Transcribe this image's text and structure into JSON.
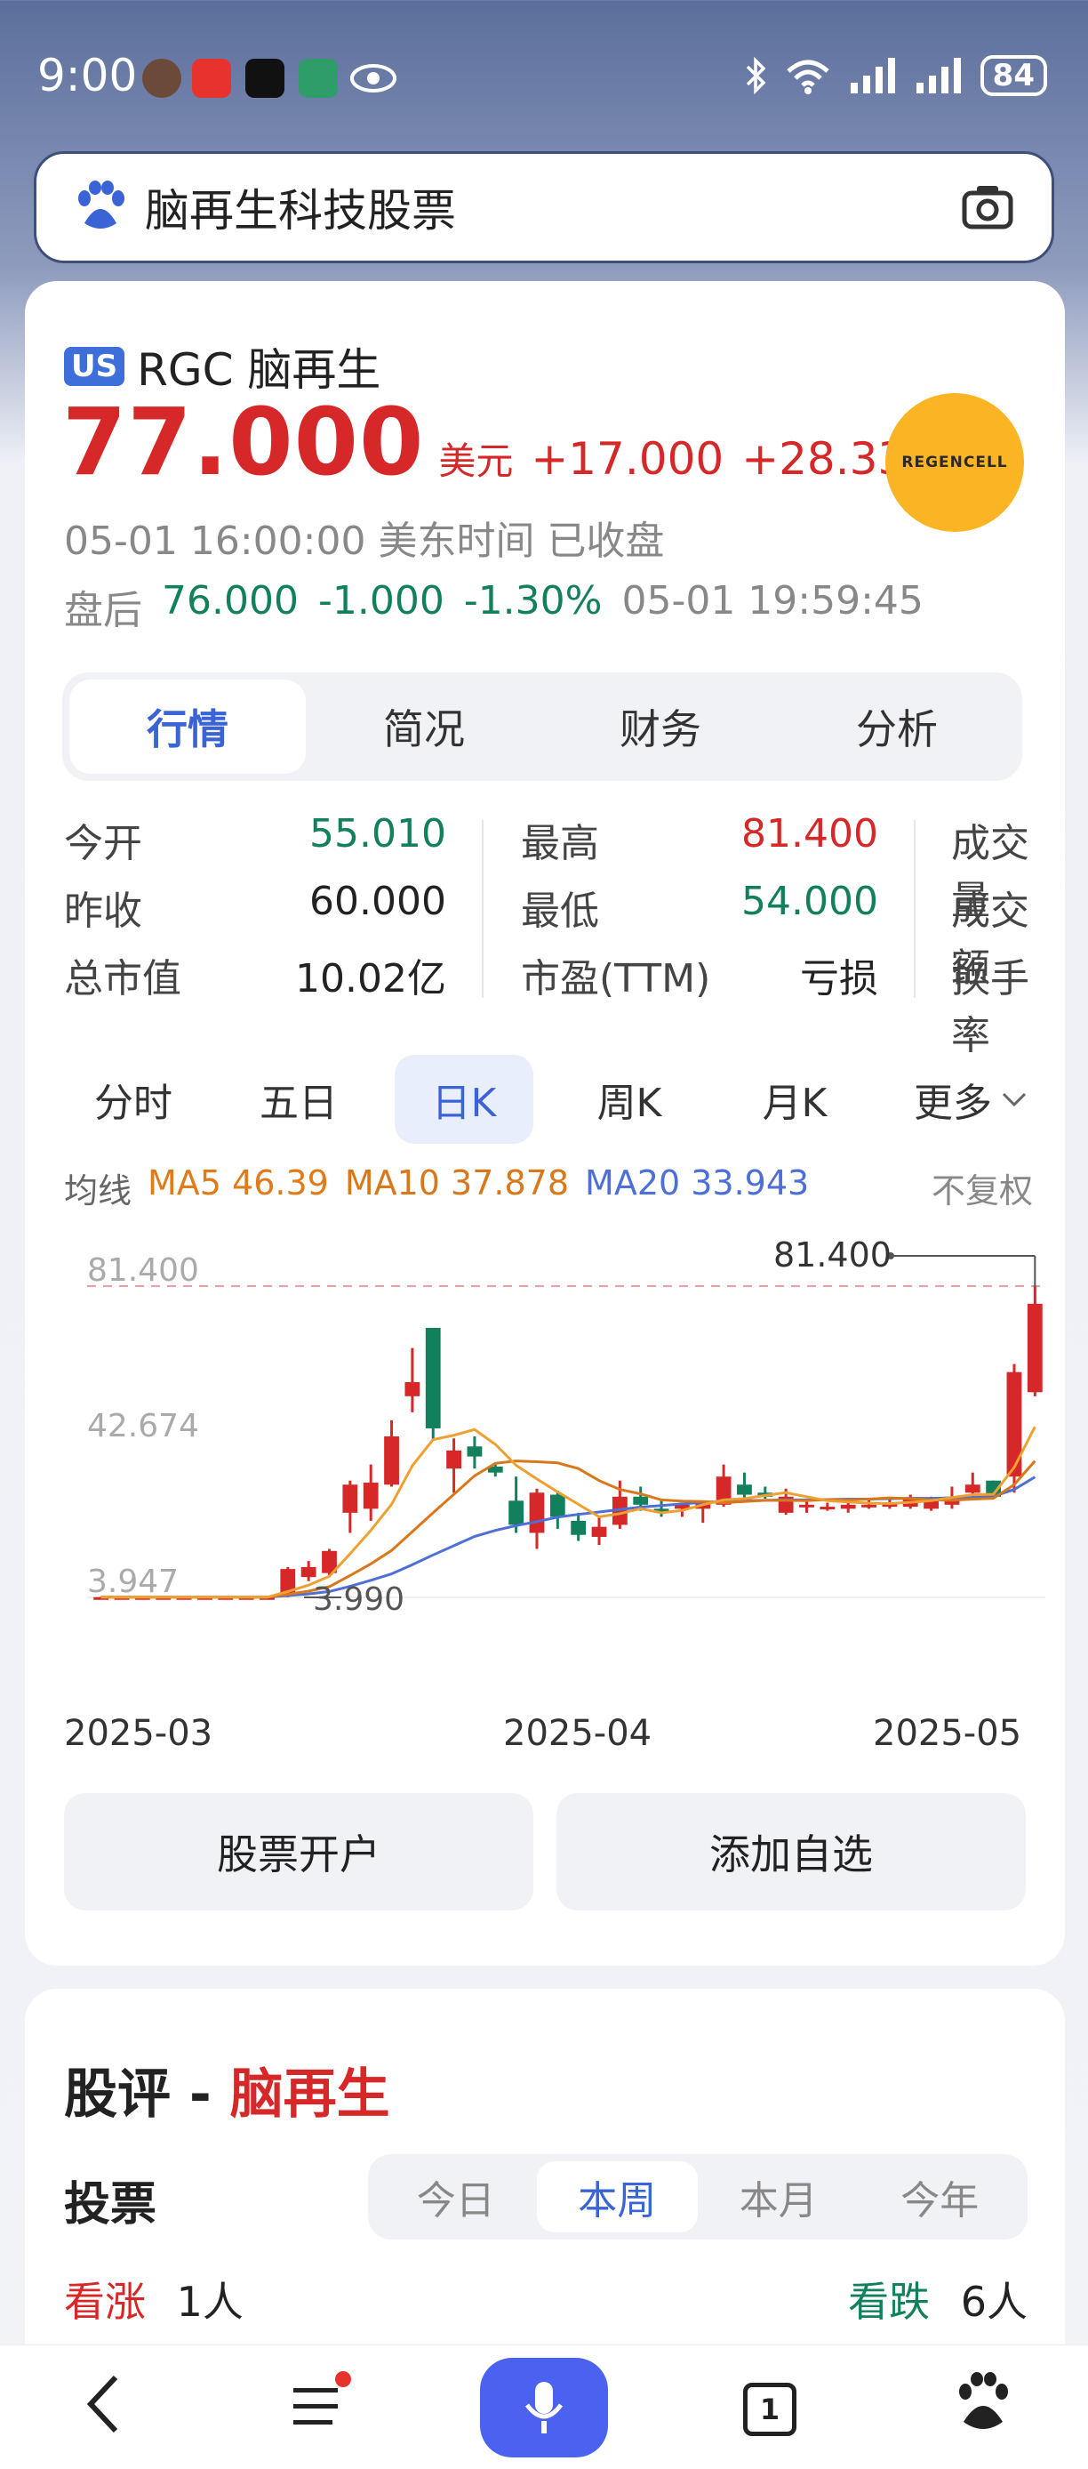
{
  "status_bar": {
    "time": "9:00",
    "battery": "84"
  },
  "search": {
    "query": "脑再生科技股票"
  },
  "stock": {
    "market_badge": "US",
    "name": "RGC 脑再生",
    "price": "77.000",
    "currency": "美元",
    "change": "+17.000",
    "change_pct": "+28.33%",
    "quote_time": "05-01 16:00:00 美东时间 已收盘",
    "after_hours_label": "盘后",
    "after_price": "76.000",
    "after_change": "-1.000",
    "after_change_pct": "-1.30%",
    "after_time": "05-01 19:59:45",
    "logo_text": "REGENCELL"
  },
  "tabs": [
    "行情",
    "简况",
    "财务",
    "分析"
  ],
  "quote_grid": {
    "open_label": "今开",
    "open": "55.010",
    "prev_close_label": "昨收",
    "prev_close": "60.000",
    "mcap_label": "总市值",
    "mcap": "10.02亿",
    "high_label": "最高",
    "high": "81.400",
    "low_label": "最低",
    "low": "54.000",
    "pe_label": "市盈(TTM)",
    "pe": "亏损",
    "volume_label": "成交量",
    "turnover_label": "成交额",
    "turnover_rate_label": "换手率"
  },
  "period_tabs": [
    "分时",
    "五日",
    "日K",
    "周K",
    "月K"
  ],
  "period_more": "更多",
  "ma": {
    "label": "均线",
    "ma5": "MA5 46.39",
    "ma10": "MA10 37.878",
    "ma20": "MA20 33.943",
    "adjust": "不复权"
  },
  "colors": {
    "up": "#d62828",
    "down": "#12805c",
    "ma5": "#e07b1a",
    "ma10": "#d9781a",
    "ma20": "#4d6fd6",
    "accent": "#3a63d6"
  },
  "chart_data": {
    "type": "candlestick",
    "ylabels": [
      "81.400",
      "42.674",
      "3.947"
    ],
    "high_annotation": "81.400",
    "low_annotation": "3.990",
    "xlabels": [
      "2025-03",
      "2025-04",
      "2025-05"
    ],
    "ylim": [
      3.947,
      81.4
    ],
    "candles": [
      {
        "o": 4.0,
        "c": 4.0,
        "h": 4.1,
        "l": 3.95
      },
      {
        "o": 4.0,
        "c": 4.0,
        "h": 4.1,
        "l": 3.95
      },
      {
        "o": 4.0,
        "c": 4.0,
        "h": 4.1,
        "l": 3.95
      },
      {
        "o": 4.0,
        "c": 4.0,
        "h": 4.1,
        "l": 3.95
      },
      {
        "o": 4.0,
        "c": 4.0,
        "h": 4.1,
        "l": 3.95
      },
      {
        "o": 4.0,
        "c": 4.0,
        "h": 4.1,
        "l": 3.95
      },
      {
        "o": 4.0,
        "c": 4.0,
        "h": 4.1,
        "l": 3.99
      },
      {
        "o": 4.0,
        "c": 4.0,
        "h": 4.1,
        "l": 3.99
      },
      {
        "o": 4.0,
        "c": 4.0,
        "h": 4.1,
        "l": 3.99
      },
      {
        "o": 4.5,
        "c": 11.0,
        "h": 11.5,
        "l": 3.99
      },
      {
        "o": 9.0,
        "c": 11.5,
        "h": 13.0,
        "l": 8.0
      },
      {
        "o": 10.0,
        "c": 15.5,
        "h": 16.0,
        "l": 9.5
      },
      {
        "o": 25.0,
        "c": 32.0,
        "h": 33.0,
        "l": 20.0
      },
      {
        "o": 26.0,
        "c": 32.5,
        "h": 37.0,
        "l": 23.0
      },
      {
        "o": 32.0,
        "c": 44.0,
        "h": 48.0,
        "l": 31.5
      },
      {
        "o": 54.0,
        "c": 57.5,
        "h": 66.0,
        "l": 50.0
      },
      {
        "o": 71.0,
        "c": 46.0,
        "h": 71.0,
        "l": 43.0
      },
      {
        "o": 36.0,
        "c": 40.5,
        "h": 43.5,
        "l": 30.0
      },
      {
        "o": 41.5,
        "c": 39.0,
        "h": 44.0,
        "l": 36.0
      },
      {
        "o": 36.5,
        "c": 35.0,
        "h": 37.0,
        "l": 34.0
      },
      {
        "o": 28.0,
        "c": 22.0,
        "h": 34.0,
        "l": 20.0
      },
      {
        "o": 20.0,
        "c": 30.0,
        "h": 31.0,
        "l": 16.0
      },
      {
        "o": 29.5,
        "c": 24.0,
        "h": 30.5,
        "l": 21.0
      },
      {
        "o": 23.0,
        "c": 19.5,
        "h": 25.0,
        "l": 18.0
      },
      {
        "o": 19.0,
        "c": 21.5,
        "h": 24.0,
        "l": 17.0
      },
      {
        "o": 22.0,
        "c": 29.0,
        "h": 33.0,
        "l": 21.0
      },
      {
        "o": 29.0,
        "c": 27.0,
        "h": 31.5,
        "l": 25.5
      },
      {
        "o": 26.0,
        "c": 25.0,
        "h": 28.0,
        "l": 24.0
      },
      {
        "o": 26.0,
        "c": 27.0,
        "h": 27.5,
        "l": 24.0
      },
      {
        "o": 26.0,
        "c": 27.5,
        "h": 28.0,
        "l": 22.5
      },
      {
        "o": 27.0,
        "c": 34.0,
        "h": 37.0,
        "l": 26.5
      },
      {
        "o": 32.0,
        "c": 29.5,
        "h": 35.0,
        "l": 28.0
      },
      {
        "o": 30.0,
        "c": 29.0,
        "h": 31.5,
        "l": 28.5
      },
      {
        "o": 25.0,
        "c": 29.0,
        "h": 31.0,
        "l": 24.5
      },
      {
        "o": 26.5,
        "c": 27.0,
        "h": 28.5,
        "l": 25.0
      },
      {
        "o": 26.0,
        "c": 26.5,
        "h": 27.5,
        "l": 25.5
      },
      {
        "o": 26.0,
        "c": 27.0,
        "h": 28.0,
        "l": 25.0
      },
      {
        "o": 26.5,
        "c": 27.0,
        "h": 28.5,
        "l": 26.0
      },
      {
        "o": 26.5,
        "c": 27.5,
        "h": 28.5,
        "l": 26.0
      },
      {
        "o": 26.5,
        "c": 28.5,
        "h": 29.5,
        "l": 26.0
      },
      {
        "o": 26.0,
        "c": 28.0,
        "h": 29.0,
        "l": 25.5
      },
      {
        "o": 27.0,
        "c": 29.0,
        "h": 31.5,
        "l": 26.0
      },
      {
        "o": 30.0,
        "c": 32.0,
        "h": 35.0,
        "l": 28.5
      },
      {
        "o": 33.0,
        "c": 29.0,
        "h": 33.0,
        "l": 28.5
      },
      {
        "o": 34.0,
        "c": 60.0,
        "h": 62.0,
        "l": 30.0
      },
      {
        "o": 55.0,
        "c": 77.0,
        "h": 81.4,
        "l": 54.0
      }
    ],
    "ma5": [
      4.0,
      4.0,
      4.0,
      4.0,
      4.0,
      4.0,
      4.0,
      4.0,
      4.0,
      5.4,
      7.0,
      9.2,
      14.8,
      20.6,
      27.1,
      36.7,
      43.2,
      44.3,
      45.7,
      42.0,
      36.8,
      33.4,
      30.2,
      27.1,
      24.0,
      24.8,
      26.0,
      25.0,
      25.6,
      27.0,
      28.2,
      28.5,
      29.3,
      30.0,
      29.0,
      28.0,
      27.7,
      27.4,
      27.3,
      27.6,
      28.0,
      28.8,
      29.5,
      29.6,
      36.3,
      46.4
    ],
    "ma10": [
      4.0,
      4.0,
      4.0,
      4.0,
      4.0,
      4.0,
      4.0,
      4.0,
      4.0,
      4.7,
      5.5,
      6.6,
      9.4,
      12.3,
      15.6,
      20.3,
      25.0,
      29.6,
      34.2,
      37.3,
      37.9,
      37.7,
      37.4,
      36.0,
      33.0,
      30.8,
      29.7,
      28.2,
      27.9,
      27.8,
      27.5,
      27.8,
      28.1,
      28.1,
      28.0,
      28.3,
      28.2,
      28.4,
      28.7,
      28.5,
      28.2,
      28.1,
      28.4,
      28.6,
      32.0,
      37.9
    ],
    "ma20": [
      4.0,
      4.0,
      4.0,
      4.0,
      4.0,
      4.0,
      4.0,
      4.0,
      4.0,
      4.4,
      4.8,
      5.4,
      6.7,
      8.2,
      9.8,
      12.1,
      14.5,
      16.8,
      19.1,
      20.6,
      21.8,
      22.8,
      23.9,
      24.6,
      25.2,
      25.8,
      26.4,
      26.8,
      27.2,
      27.6,
      27.8,
      28.0,
      28.1,
      28.2,
      28.2,
      28.3,
      28.4,
      28.4,
      28.5,
      28.6,
      28.6,
      28.7,
      28.8,
      29.1,
      30.8,
      33.9
    ]
  },
  "buttons": {
    "open_account": "股票开户",
    "add_watch": "添加自选"
  },
  "review": {
    "title_prefix": "股评 - ",
    "title_name": "脑再生",
    "vote_label": "投票",
    "vote_tabs": [
      "今日",
      "本周",
      "本月",
      "今年"
    ],
    "bull_label": "看涨",
    "bull_count": "1人",
    "bear_label": "看跌",
    "bear_count": "6人"
  },
  "nav": {
    "tabs_count": "1"
  }
}
